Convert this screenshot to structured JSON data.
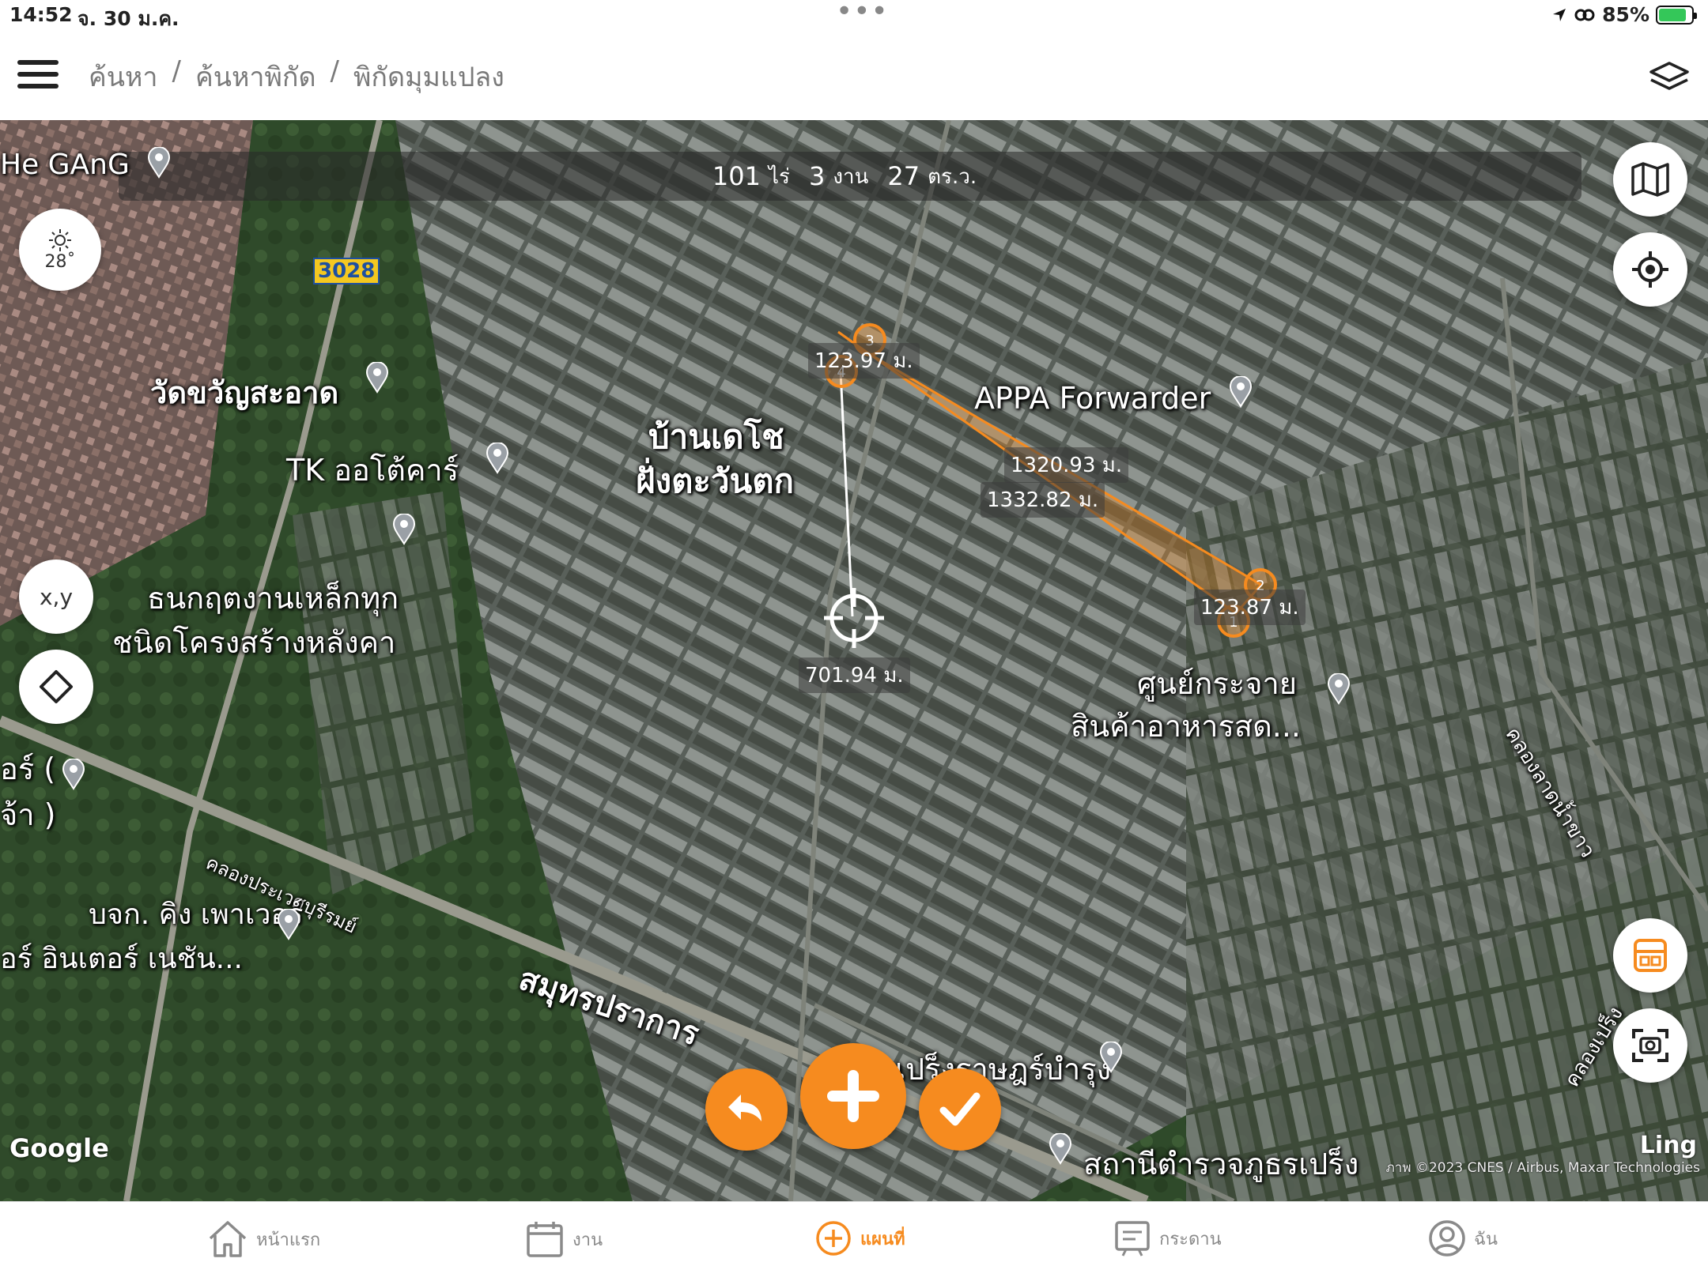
{
  "status_bar": {
    "time": "14:52",
    "date": "จ. 30 ม.ค.",
    "battery": "85%",
    "battery_level": 0.85
  },
  "header": {
    "breadcrumb": [
      "ค้นหา",
      "/",
      "ค้นหาพิกัด",
      "/",
      "พิกัดมุมแปลง"
    ],
    "menu_icon": "hamburger-icon",
    "layers_icon": "layers-icon"
  },
  "map": {
    "area": {
      "rai": "101",
      "rai_unit": "ไร่",
      "ngan": "3",
      "ngan_unit": "งาน",
      "wa": "27",
      "wa_unit": "ตร.ว."
    },
    "weather": {
      "icon": "sun-icon",
      "temp": "28˚"
    },
    "xy_label": "x,y",
    "road_number": "3028",
    "places": {
      "he_gang": "He GAnG",
      "wat": "วัดขวัญสะอาด",
      "tk": "TK ออโต้คาร์",
      "ban1": "บ้านเดโช",
      "ban2": "ฝั่งตะวันตก",
      "thanakrit1": "ธนกฤตงานเหล็กทุก",
      "thanakrit2": "ชนิดโครงสร้างหลังคา",
      "appa": "APPA Forwarder",
      "center1": "ศูนย์กระจาย",
      "center2": "สินค้าอาหารสด...",
      "canal1": "คลองประเวศบุรีรมย์",
      "canal2": "คลองลาดน้ำขาว",
      "canal3": "คลองเปร็ง",
      "road": "สมุทรปราการ",
      "left1": "อร์ (",
      "left2": "จ้า )",
      "company1": "บจก. คิง เพาเวอร์",
      "company2": "อร์ อินเตอร์ เนชัน...",
      "school": "เปร็งราษฎร์บำรุง",
      "police": "สถานีตำรวจภูธรเปร็ง"
    },
    "measurements": {
      "m1": "123.97 ม.",
      "m2": "1320.93 ม.",
      "m3": "1332.82 ม.",
      "m4": "123.87 ม.",
      "m5": "701.94 ม."
    },
    "vertex_labels": [
      "1",
      "2",
      "3",
      "4"
    ],
    "google": "Google",
    "copyright": "ภาพ ©2023 CNES / Airbus, Maxar Technologies",
    "ling": "Ling",
    "right_buttons": [
      "map-icon",
      "locate-icon",
      "save-form-icon",
      "screenshot-icon"
    ],
    "accent_color": "#f68b1f"
  },
  "tabs": [
    {
      "label": "หน้าแรก",
      "icon": "home-icon",
      "active": false
    },
    {
      "label": "งาน",
      "icon": "calendar-icon",
      "active": false
    },
    {
      "label": "แผนที่",
      "icon": "plus-circle-icon",
      "active": true
    },
    {
      "label": "กระดาน",
      "icon": "board-icon",
      "active": false
    },
    {
      "label": "ฉัน",
      "icon": "user-icon",
      "active": false
    }
  ]
}
